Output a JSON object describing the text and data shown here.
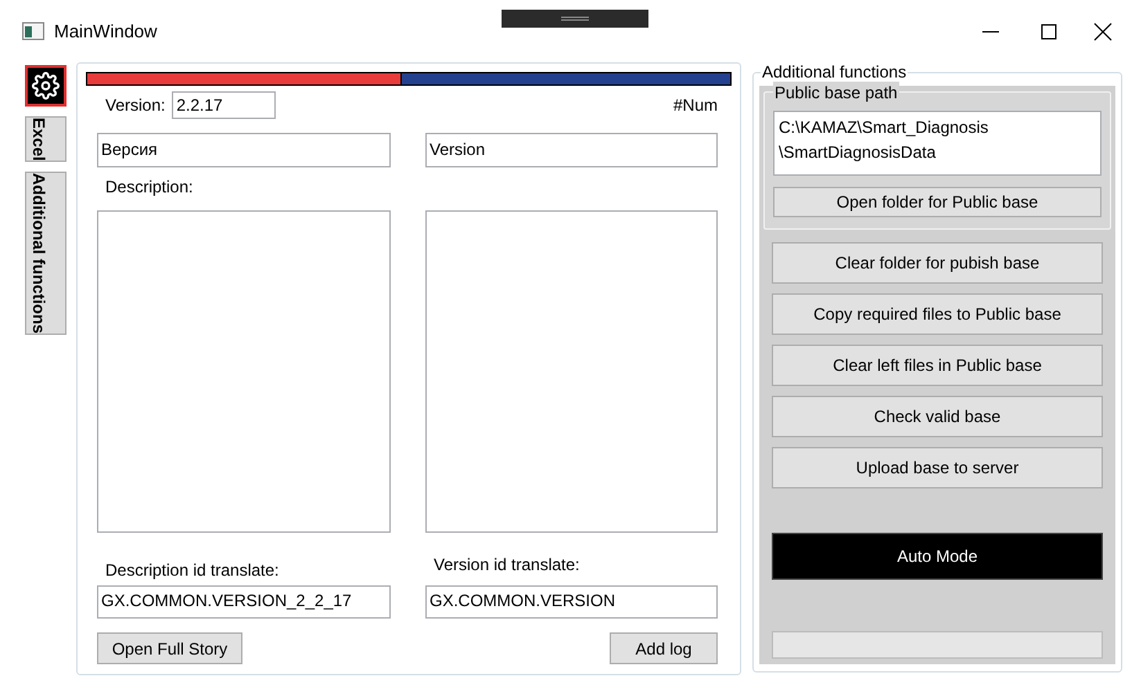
{
  "window": {
    "title": "MainWindow"
  },
  "side_tabs": [
    {
      "kind": "icon",
      "selected": true
    },
    {
      "kind": "text",
      "label": "Excel",
      "selected": false
    },
    {
      "kind": "text",
      "label": "Additional functions",
      "selected": false
    }
  ],
  "main": {
    "flag_bar": {
      "level": 0.49
    },
    "version_label": "Version:",
    "version_value": "2.2.17",
    "num_label": "#Num",
    "name_ru": "Версия",
    "name_en": "Version",
    "description_label": "Description:",
    "description_id_label": "Description id translate:",
    "description_id_value": "GX.COMMON.VERSION_2_2_17",
    "version_id_label": "Version id translate:",
    "version_id_value": "GX.COMMON.VERSION",
    "buttons": [
      "Open Full Story",
      "Add log"
    ]
  },
  "additional": {
    "title": "Additional functions",
    "public_base": {
      "title": "Public base path",
      "path": "C:\\KAMAZ\\Smart_Diagnosis\n\\SmartDiagnosisData",
      "button": "Open folder for Public base"
    },
    "buttons": [
      {
        "label": "Clear folder for pubish base",
        "kind": "normal"
      },
      {
        "label": "Copy required files to Public base",
        "kind": "normal"
      },
      {
        "label": "Clear left files in Public base",
        "kind": "normal"
      },
      {
        "label": "Check valid base",
        "kind": "normal"
      },
      {
        "label": "Upload base to server",
        "kind": "normal"
      },
      {
        "label": "Auto Mode",
        "kind": "dark"
      }
    ],
    "progress": {
      "level": 0
    }
  }
}
